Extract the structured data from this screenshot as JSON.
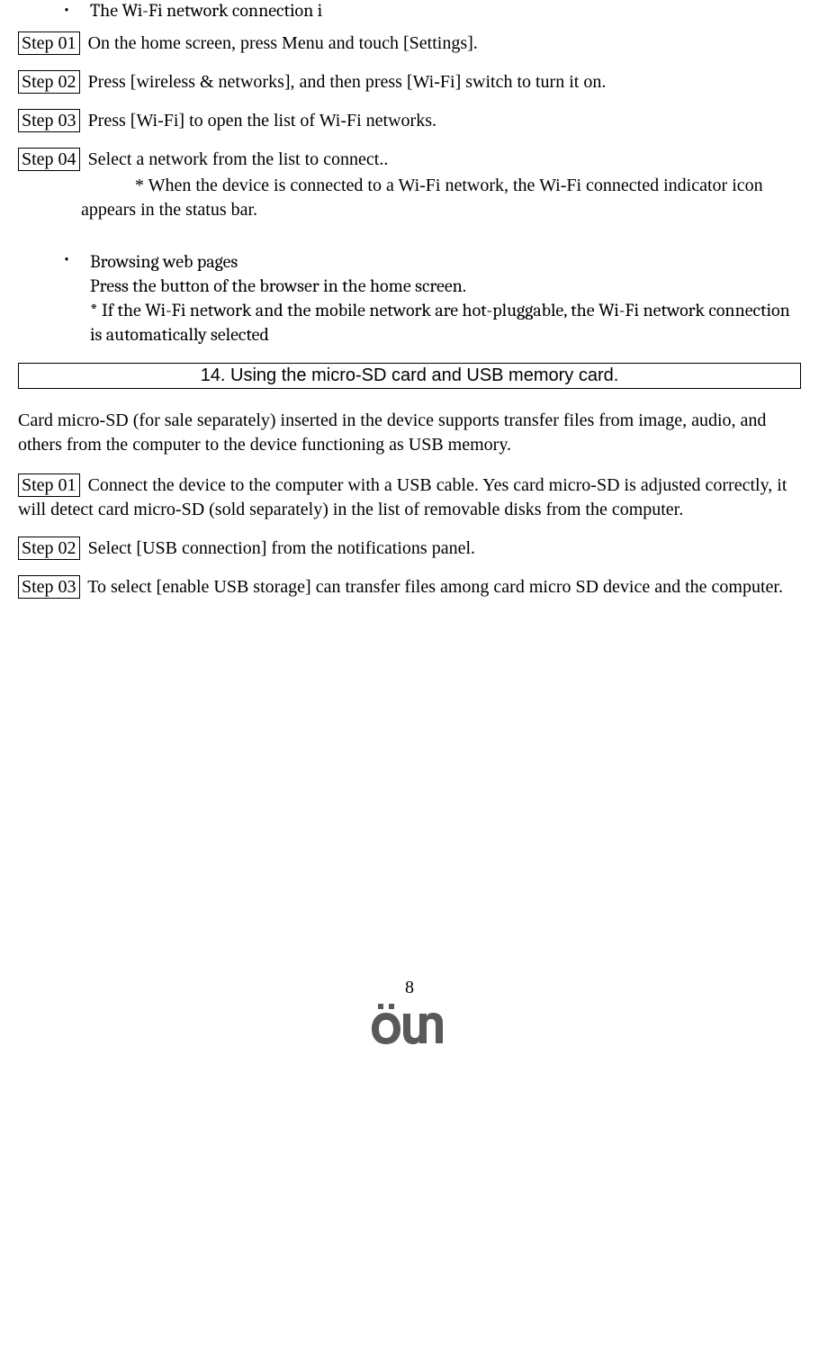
{
  "bullet1": "The Wi-Fi network connection i",
  "wifi_steps": [
    {
      "label": "Step 01",
      "text": "On the home screen, press Menu and touch [Settings]."
    },
    {
      "label": "Step 02",
      "text": "Press [wireless & networks], and then press [Wi-Fi] switch to turn it on."
    },
    {
      "label": "Step 03",
      "text": "Press [Wi-Fi] to open the list of Wi-Fi networks."
    },
    {
      "label": "Step 04",
      "text": "Select a network from the list to connect.."
    }
  ],
  "wifi_step4_sub": "* When the device is connected to a Wi-Fi network, the Wi-Fi connected indicator icon appears in the status bar.",
  "bullet2_title": "Browsing web pages",
  "bullet2_line1": "Press the button of the browser in the home screen.",
  "bullet2_line2": "* If the Wi-Fi network and the mobile network are hot-pluggable, the Wi-Fi network connection is automatically selected",
  "section_header": "14. Using the micro-SD card and USB memory card.",
  "sd_intro": "Card micro-SD (for sale separately) inserted in the device supports transfer files from image, audio, and others from the computer to the device functioning as USB memory.",
  "sd_steps": [
    {
      "label": "Step 01",
      "text": "Connect the device to the computer with a USB cable. Yes card micro-SD is adjusted correctly, it will detect card micro-SD (sold separately) in the list of removable disks from the computer.",
      "indent": true
    },
    {
      "label": "Step 02",
      "text": "Select [USB connection] from the notifications panel.",
      "indent": false
    },
    {
      "label": "Step 03",
      "text": "To select [enable USB storage] can transfer files among card micro SD device and the computer.",
      "indent": false
    }
  ],
  "page_number": "8"
}
